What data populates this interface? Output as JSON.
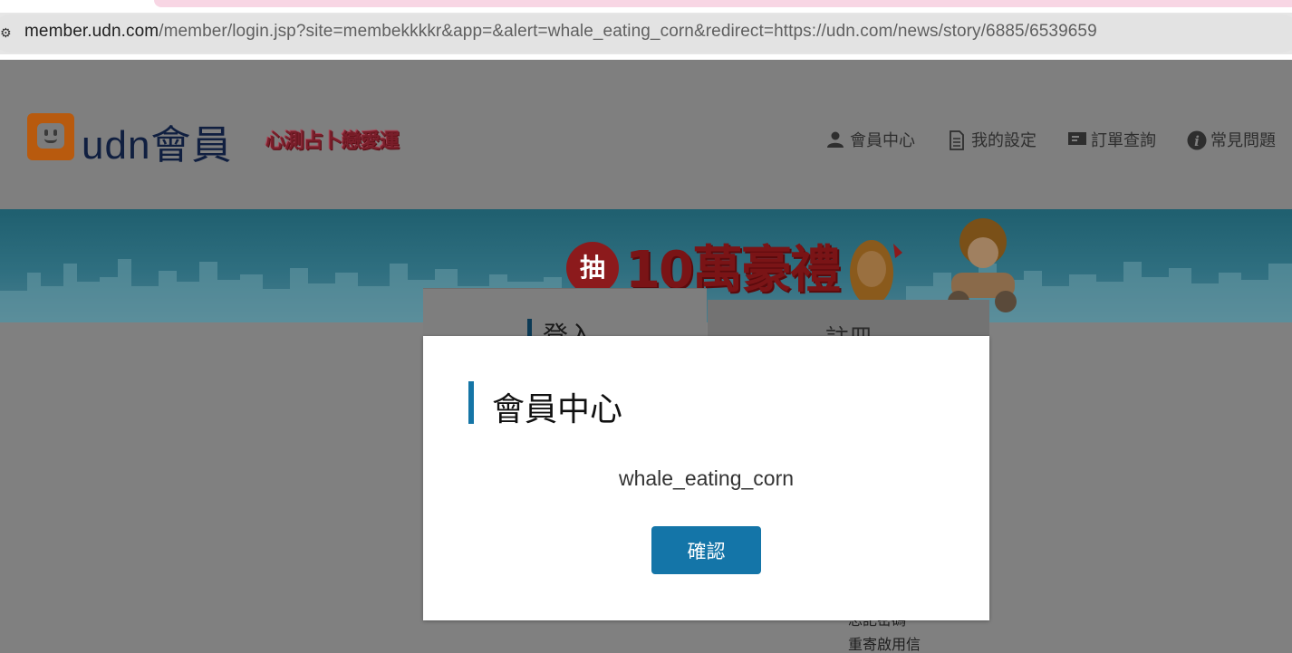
{
  "browser": {
    "url_host": "member.udn.com",
    "url_path": "/member/login.jsp?site=membekkkkr&app=&alert=whale_eating_corn&redirect=https://udn.com/news/story/6885/6539659"
  },
  "header": {
    "brand": "udn會員",
    "promo": "心測占卜戀愛運",
    "nav": [
      {
        "label": "會員中心",
        "icon": "person-icon"
      },
      {
        "label": "我的設定",
        "icon": "document-icon"
      },
      {
        "label": "訂單查詢",
        "icon": "ticket-icon"
      },
      {
        "label": "常見問題",
        "icon": "info-icon"
      }
    ]
  },
  "banner": {
    "badge": "抽",
    "headline": "10萬豪禮"
  },
  "tabs": {
    "login": "登入",
    "register": "註冊"
  },
  "footer_links": [
    "忘記密碼",
    "重寄啟用信"
  ],
  "modal": {
    "title": "會員中心",
    "message": "whale_eating_corn",
    "confirm": "確認"
  },
  "colors": {
    "accent": "#1575a6",
    "button": "#1475a8",
    "overlay": "#808080"
  }
}
